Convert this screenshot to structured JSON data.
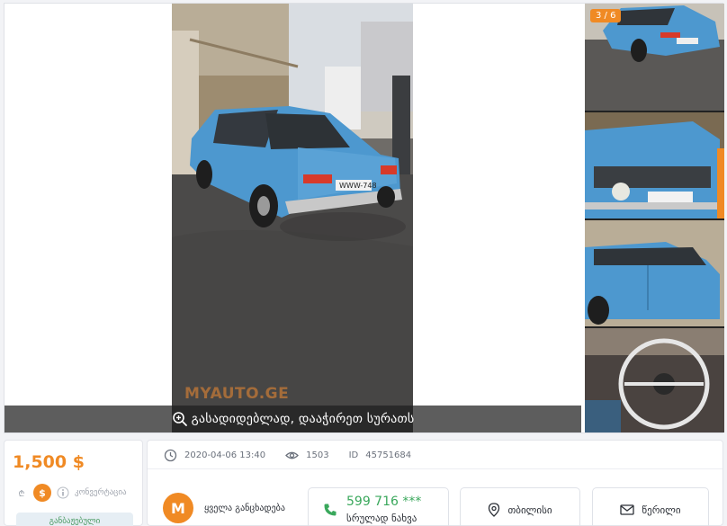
{
  "gallery": {
    "watermark": "MYAUTO.GE",
    "zoom_hint": "გასადიდებლად, დააჭირეთ სურათს",
    "counter": "3 / 6",
    "plate_text": "WWW-748"
  },
  "price": {
    "amount": "1,500 $",
    "currency_lari": "₾",
    "currency_usd": "$",
    "convert_label": "კონვერტაცია",
    "customs_label": "განბაჟებული"
  },
  "meta": {
    "date": "2020-04-06 13:40",
    "views": "1503",
    "id_label": "ID",
    "id_value": "45751684"
  },
  "seller": {
    "avatar_letter": "M",
    "label": "ყველა განცხადება"
  },
  "contact": {
    "phone": "599 716 ***",
    "show_full": "სრულად ნახვა",
    "location": "თბილისი",
    "message": "წერილი"
  },
  "colors": {
    "accent": "#f08a24",
    "green": "#3aa85c",
    "car_blue": "#4d98cf"
  }
}
